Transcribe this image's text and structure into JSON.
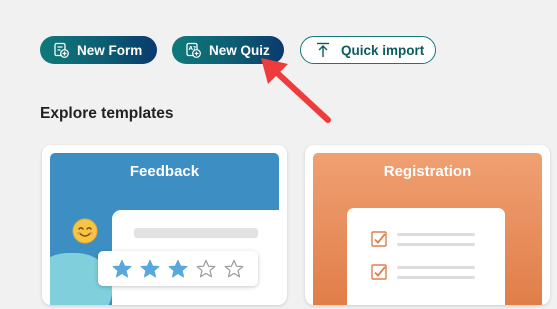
{
  "toolbar": {
    "new_form_label": "New Form",
    "new_quiz_label": "New Quiz",
    "quick_import_label": "Quick import"
  },
  "templates": {
    "section_title": "Explore templates",
    "cards": [
      {
        "title": "Feedback",
        "rating": 3,
        "rating_max": 5
      },
      {
        "title": "Registration"
      }
    ]
  },
  "colors": {
    "button_gradient_start": "#0f7a7a",
    "button_gradient_end": "#093a6d",
    "feedback_banner": "#3d8fc3",
    "registration_banner": "#e8905a",
    "star_filled": "#5aa7db",
    "checkbox": "#e07e49",
    "annotation_arrow": "#ee3c3c"
  },
  "icons": {
    "new_form": "form-plus-icon",
    "new_quiz": "quiz-plus-icon",
    "quick_import": "upload-icon"
  }
}
